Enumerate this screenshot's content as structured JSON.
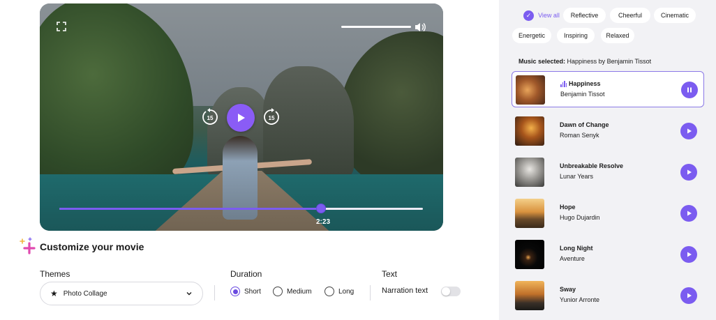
{
  "player": {
    "current_time": "2:23",
    "progress_fraction": 0.72,
    "volume_fraction": 1.0,
    "rewind_seconds": "15",
    "forward_seconds": "15"
  },
  "customize": {
    "title": "Customize your movie",
    "themes": {
      "label": "Themes",
      "value": "Photo Collage"
    },
    "duration": {
      "label": "Duration",
      "options": [
        "Short",
        "Medium",
        "Long"
      ],
      "selected": "Short"
    },
    "text": {
      "label": "Text",
      "narration_label": "Narration text",
      "narration_on": false
    }
  },
  "music": {
    "filters": [
      "View all",
      "Reflective",
      "Cheerful",
      "Cinematic",
      "Energetic",
      "Inspiring",
      "Relaxed"
    ],
    "active_filter": "View all",
    "selected_label": "Music selected:",
    "selected_value": "Happiness by Benjamin Tissot",
    "tracks": [
      {
        "title": "Happiness",
        "artist": "Benjamin Tissot",
        "state": "playing"
      },
      {
        "title": "Dawn of Change",
        "artist": "Roman Senyk",
        "state": "paused"
      },
      {
        "title": "Unbreakable Resolve",
        "artist": "Lunar Years",
        "state": "paused"
      },
      {
        "title": "Hope",
        "artist": "Hugo Dujardin",
        "state": "paused"
      },
      {
        "title": "Long Night",
        "artist": "Aventure",
        "state": "paused"
      },
      {
        "title": "Sway",
        "artist": "Yunior Arronte",
        "state": "paused"
      }
    ]
  },
  "colors": {
    "accent": "#7b5cf0",
    "panel_bg": "#f2f2f5"
  }
}
